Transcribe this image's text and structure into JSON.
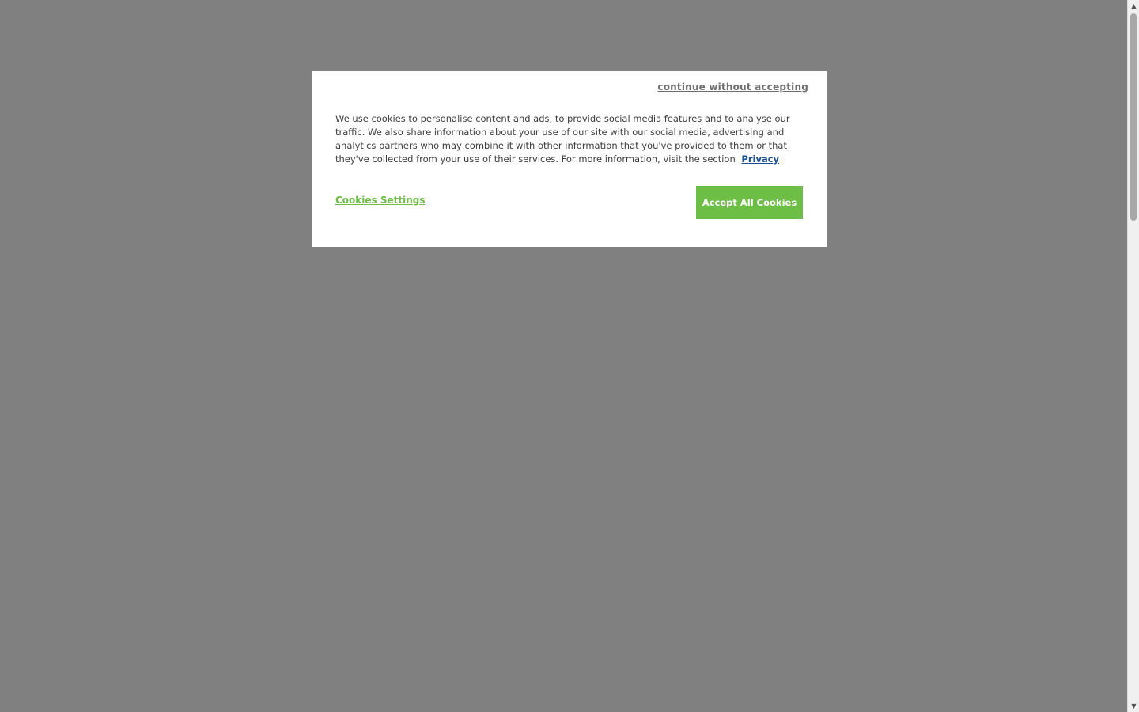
{
  "cookie_banner": {
    "continue_without_accepting": "continue without accepting",
    "description": "We use cookies to personalise content and ads, to provide social media features and to analyse our traffic. We also share information about your use of our site with our social media, advertising and analytics partners who may combine it with other information that you've provided to them or that they've collected from your use of their services. For more information, visit the section",
    "privacy_link": "Privacy",
    "settings_label": "Cookies Settings",
    "accept_label": "Accept All Cookies"
  },
  "colors": {
    "overlay": "#808080",
    "accent_green": "#6cbe45",
    "privacy_link": "#1b4f9c"
  },
  "scrollbar": {
    "up_icon": "arrow-up-icon",
    "down_icon": "arrow-down-icon"
  }
}
